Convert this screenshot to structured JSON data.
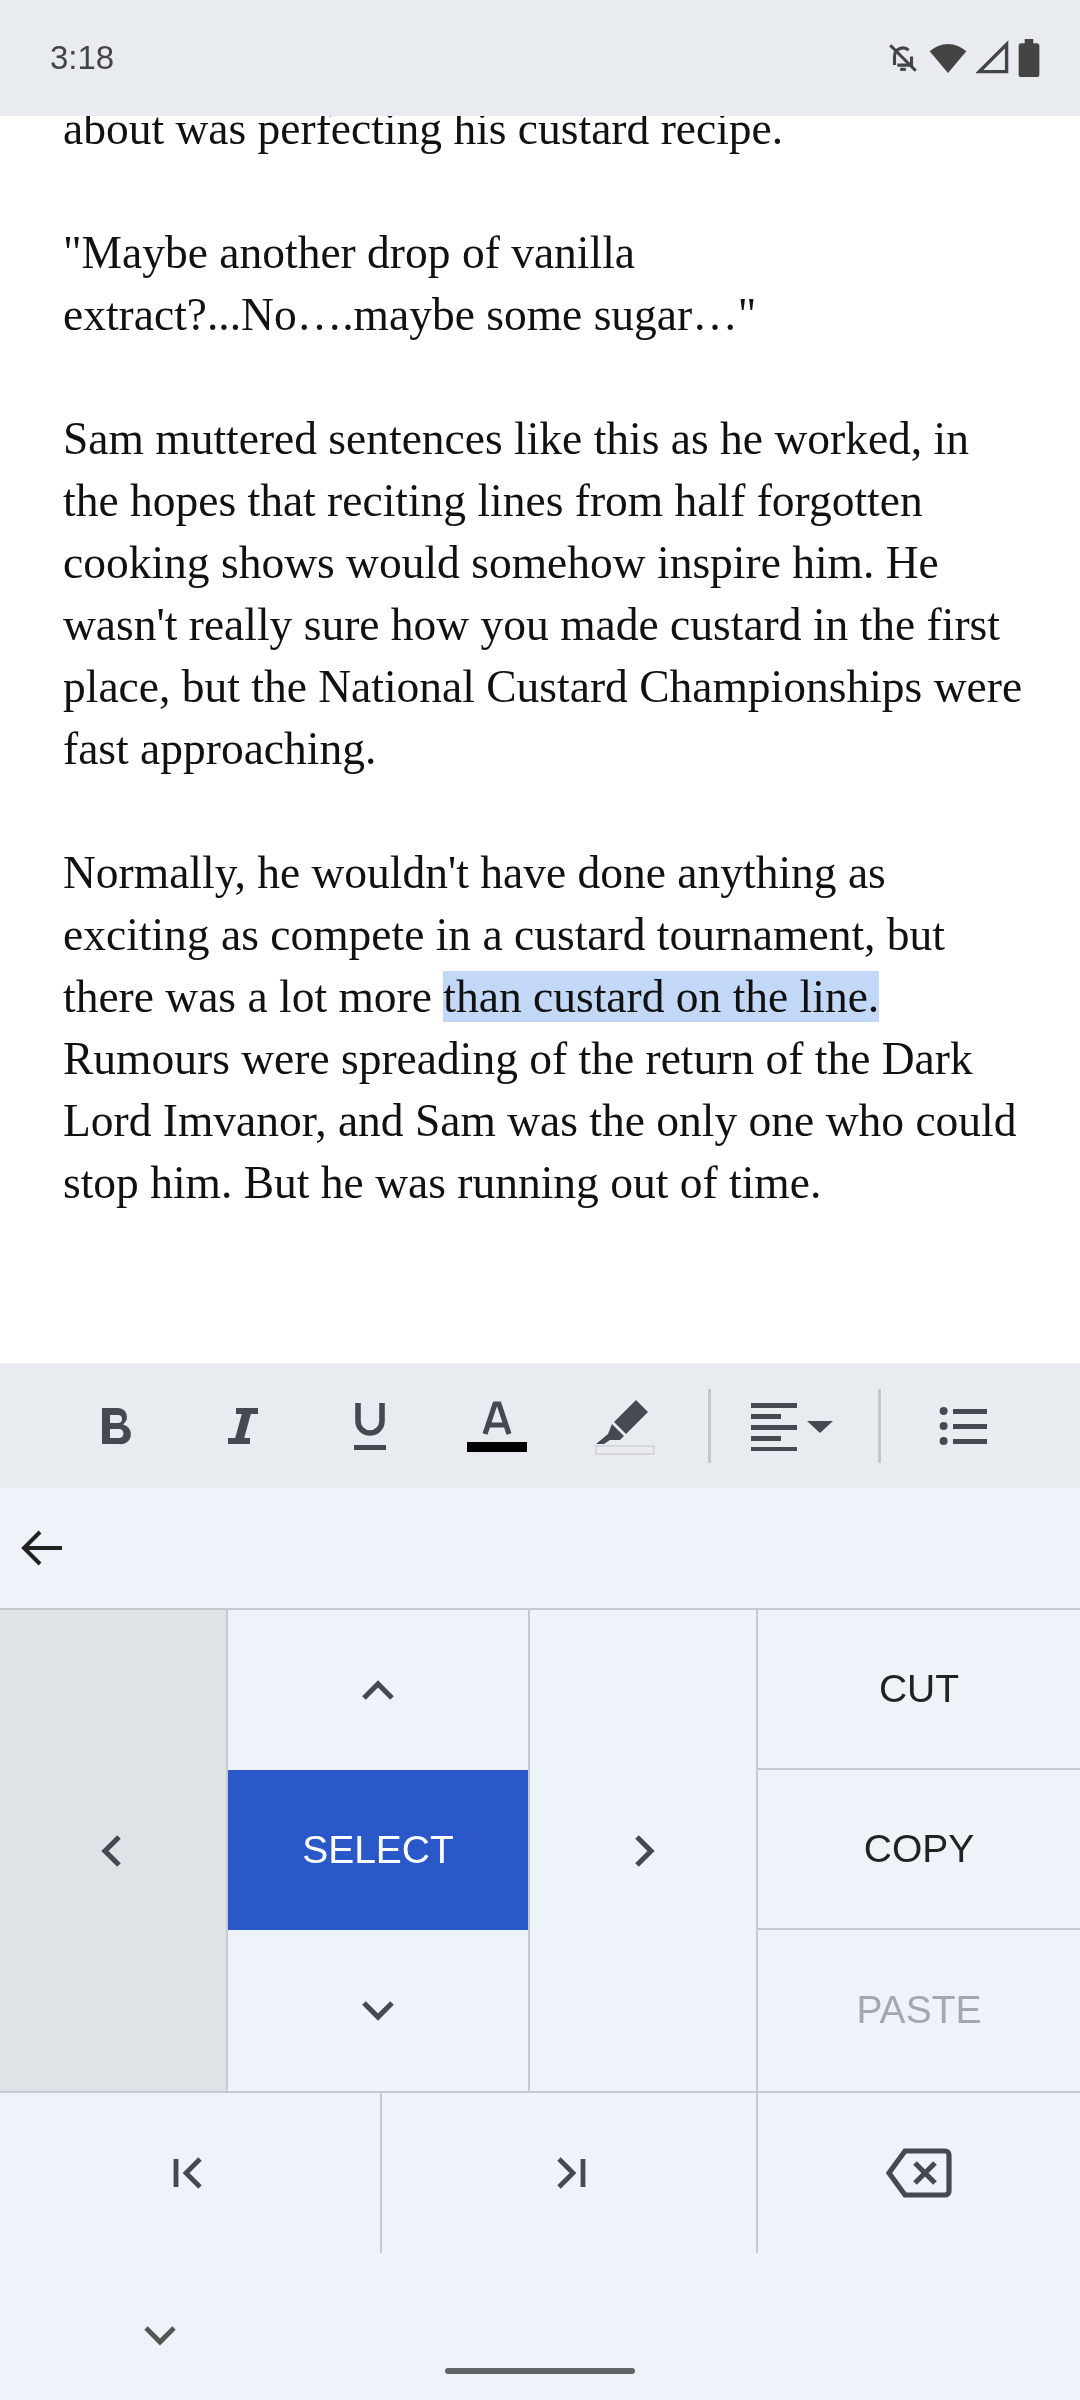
{
  "status_bar": {
    "time": "3:18"
  },
  "document": {
    "paragraphs": [
      {
        "segments": [
          {
            "text": "about was perfecting his custard recipe.",
            "selected": false
          }
        ]
      },
      {
        "segments": [
          {
            "text": "\"Maybe another drop of vanilla extract?...No….maybe some sugar…\"",
            "selected": false
          }
        ]
      },
      {
        "segments": [
          {
            "text": "Sam muttered sentences like this as he worked, in the hopes that reciting lines from half forgotten cooking shows would somehow inspire him. He wasn't really sure how you made custard in the first place, but the National Custard Championships were fast approaching.",
            "selected": false
          }
        ]
      },
      {
        "segments": [
          {
            "text": "Normally, he wouldn't have done anything as exciting as compete in a custard tournament, but there was a lot more ",
            "selected": false
          },
          {
            "text": "than custard on the line.",
            "selected": true
          },
          {
            "text": " Rumours were spreading of the return of the Dark Lord Imvanor, and Sam was the only one who could stop him. But he was running out of time.",
            "selected": false
          }
        ]
      }
    ]
  },
  "format_toolbar": {
    "buttons": [
      {
        "kind": "bold"
      },
      {
        "kind": "italic"
      },
      {
        "kind": "underline"
      },
      {
        "kind": "text-color",
        "color": "#000000"
      },
      {
        "kind": "highlight"
      },
      {
        "kind": "divider"
      },
      {
        "kind": "align"
      },
      {
        "kind": "divider"
      },
      {
        "kind": "list"
      }
    ]
  },
  "keypad": {
    "select": {
      "label": "SELECT",
      "active": true
    },
    "actions": [
      {
        "label": "CUT",
        "disabled": false
      },
      {
        "label": "COPY",
        "disabled": false
      },
      {
        "label": "PASTE",
        "disabled": true
      }
    ]
  }
}
